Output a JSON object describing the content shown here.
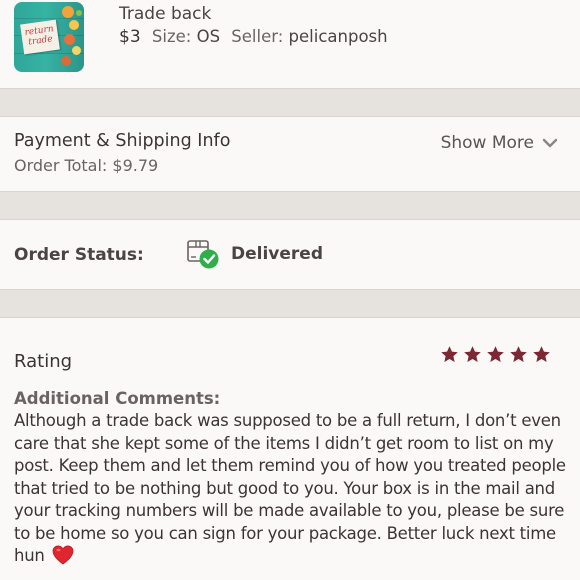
{
  "item": {
    "title": "Trade back",
    "price": "$3",
    "size_label": "Size:",
    "size": "OS",
    "seller_label": "Seller:",
    "seller": "pelicanposh",
    "thumbnail_text_line1": "return",
    "thumbnail_text_line2": "trade",
    "thumbnail_icon": "listing-photo"
  },
  "payment": {
    "title": "Payment & Shipping Info",
    "order_total": "Order Total: $9.79",
    "show_more_label": "Show More",
    "show_more_icon": "chevron-down-icon"
  },
  "order_status": {
    "label": "Order Status:",
    "value": "Delivered",
    "icon": "delivered-box-check-icon"
  },
  "rating": {
    "label": "Rating",
    "stars": 5,
    "max_stars": 5,
    "star_color": "#7b2834",
    "comments_label": "Additional Comments:",
    "comments_text": "Although a trade back was supposed to be a full return, I don’t even care that she kept some of the items I didn’t get room to list on my post. Keep them and let them remind you of how you treated people that tried to be nothing but good to you. Your box is in the mail and your tracking numbers will be made available to you, please be sure to be home so you can sign for your package. Better luck next time hun",
    "comments_emoji": "heart-icon"
  },
  "colors": {
    "page_background": "#fbf9f8",
    "separator_background": "#e6e2de",
    "check_green": "#2fae4a",
    "heart_red": "#e0252f"
  }
}
